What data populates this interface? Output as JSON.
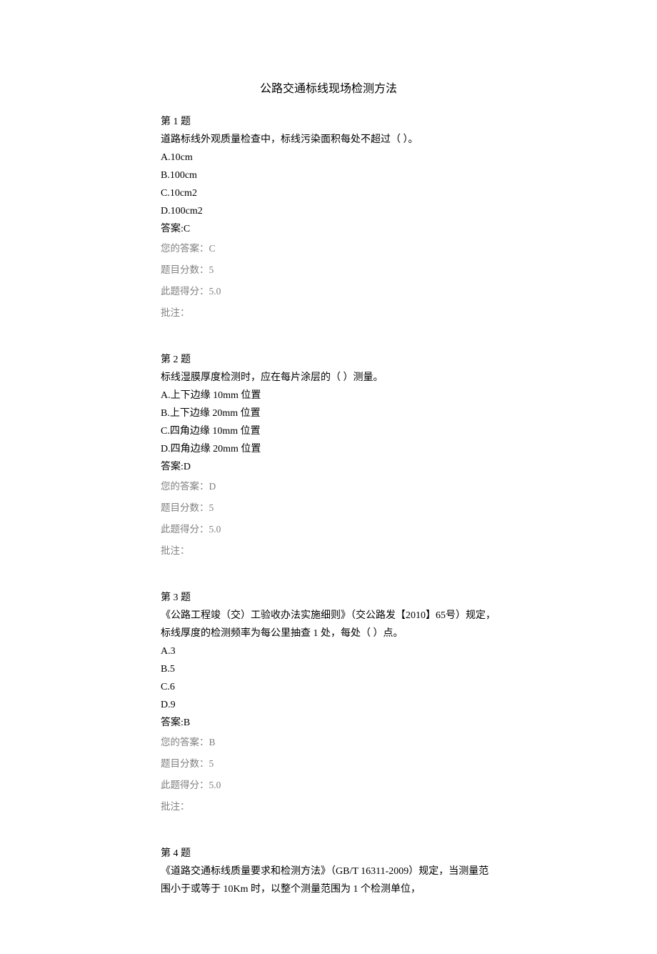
{
  "title": "公路交通标线现场检测方法",
  "questions": [
    {
      "header": "第 1 题",
      "stem": "道路标线外观质量检查中，标线污染面积每处不超过（ ）。",
      "options": [
        "A.10cm",
        "B.100cm",
        "C.10cm2",
        "D.100cm2"
      ],
      "answer_label": "答案:C",
      "your_answer": "您的答案：C",
      "item_score": "题目分数：5",
      "got_score": "此题得分：5.0",
      "comment": "批注："
    },
    {
      "header": "第 2 题",
      "stem": "标线湿膜厚度检测时，应在每片涂层的（ ）测量。",
      "options": [
        "A.上下边缘 10mm 位置",
        "B.上下边缘 20mm 位置",
        "C.四角边缘 10mm 位置",
        "D.四角边缘 20mm 位置"
      ],
      "answer_label": "答案:D",
      "your_answer": "您的答案：D",
      "item_score": "题目分数：5",
      "got_score": "此题得分：5.0",
      "comment": "批注："
    },
    {
      "header": "第 3 题",
      "stem": "《公路工程竣（交）工验收办法实施细则》（交公路发【2010】65号）规定，标线厚度的检测频率为每公里抽查 1 处，每处（ ）点。",
      "options": [
        "A.3",
        "B.5",
        "C.6",
        "D.9"
      ],
      "answer_label": "答案:B",
      "your_answer": "您的答案：B",
      "item_score": "题目分数：5",
      "got_score": "此题得分：5.0",
      "comment": "批注："
    },
    {
      "header": "第 4 题",
      "stem": "《道路交通标线质量要求和检测方法》（GB/T 16311-2009）规定，当测量范围小于或等于 10Km 时，以整个测量范围为 1 个检测单位，",
      "options": [],
      "answer_label": "",
      "your_answer": "",
      "item_score": "",
      "got_score": "",
      "comment": ""
    }
  ]
}
